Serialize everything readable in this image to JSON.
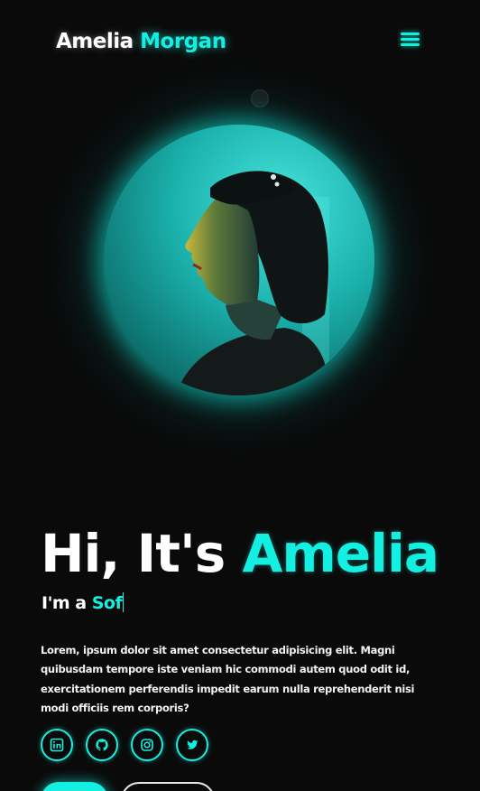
{
  "header": {
    "logo_first": "Amelia",
    "logo_last": "Morgan",
    "menu_icon": "hamburger-menu-icon"
  },
  "hero": {
    "greeting_prefix": "Hi, It's",
    "greeting_name": "Amelia",
    "role_prefix": "I'm a",
    "role_typed": "Sof",
    "intro": "Lorem, ipsum dolor sit amet consectetur adipisicing elit. Magni quibusdam tempore iste veniam hic commodi autem quod odit id, exercitationem perferendis impedit earum nulla reprehenderit nisi modi officiis rem corporis?"
  },
  "socials": [
    {
      "icon": "linkedin-icon"
    },
    {
      "icon": "github-icon"
    },
    {
      "icon": "instagram-icon"
    },
    {
      "icon": "twitter-icon"
    }
  ],
  "colors": {
    "accent": "#13f0e2",
    "background": "#0a0a0a",
    "text": "#ffffff"
  }
}
